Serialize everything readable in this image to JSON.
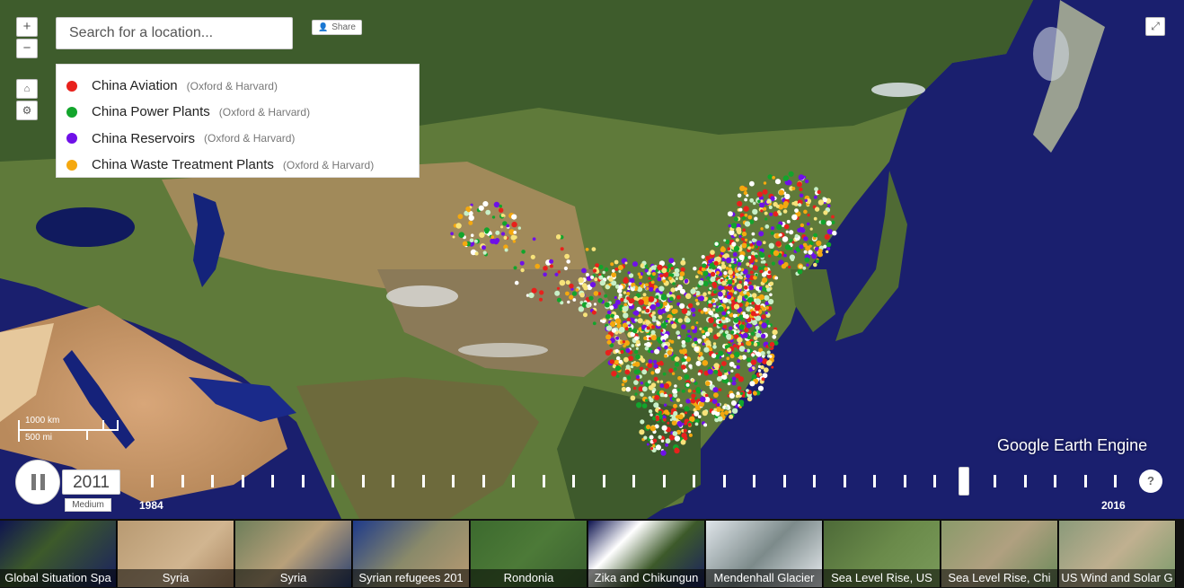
{
  "map": {
    "zoom_in_label": "+",
    "zoom_out_label": "−",
    "home_icon": "home-icon",
    "settings_icon": "gear-icon",
    "search_placeholder": "Search for a location...",
    "share_label": "Share",
    "expand_icon": "expand-icon",
    "brand": "Google Earth Engine",
    "scale": {
      "km": "1000 km",
      "mi": "500 mi"
    }
  },
  "legend": {
    "items": [
      {
        "name": "China Aviation",
        "source": "(Oxford & Harvard)",
        "color": "#e8211c"
      },
      {
        "name": "China Power Plants",
        "source": "(Oxford & Harvard)",
        "color": "#12a52c"
      },
      {
        "name": "China Reservoirs",
        "source": "(Oxford & Harvard)",
        "color": "#6f10e8"
      },
      {
        "name": "China Waste Treatment Plants",
        "source": "(Oxford & Harvard)",
        "color": "#f5a80f"
      }
    ]
  },
  "timeline": {
    "current_year": "2011",
    "speed": "Medium",
    "start_year": "1984",
    "end_year": "2016",
    "current_fraction": 0.844,
    "help_label": "?"
  },
  "carousel": {
    "items": [
      {
        "label": "Global Situation Spa"
      },
      {
        "label": "Syria"
      },
      {
        "label": "Syria"
      },
      {
        "label": "Syrian refugees 201"
      },
      {
        "label": "Rondonia"
      },
      {
        "label": "Zika and Chikungun"
      },
      {
        "label": "Mendenhall Glacier"
      },
      {
        "label": "Sea Level Rise, US"
      },
      {
        "label": "Sea Level Rise, Chi"
      },
      {
        "label": "US Wind and Solar G"
      }
    ]
  }
}
